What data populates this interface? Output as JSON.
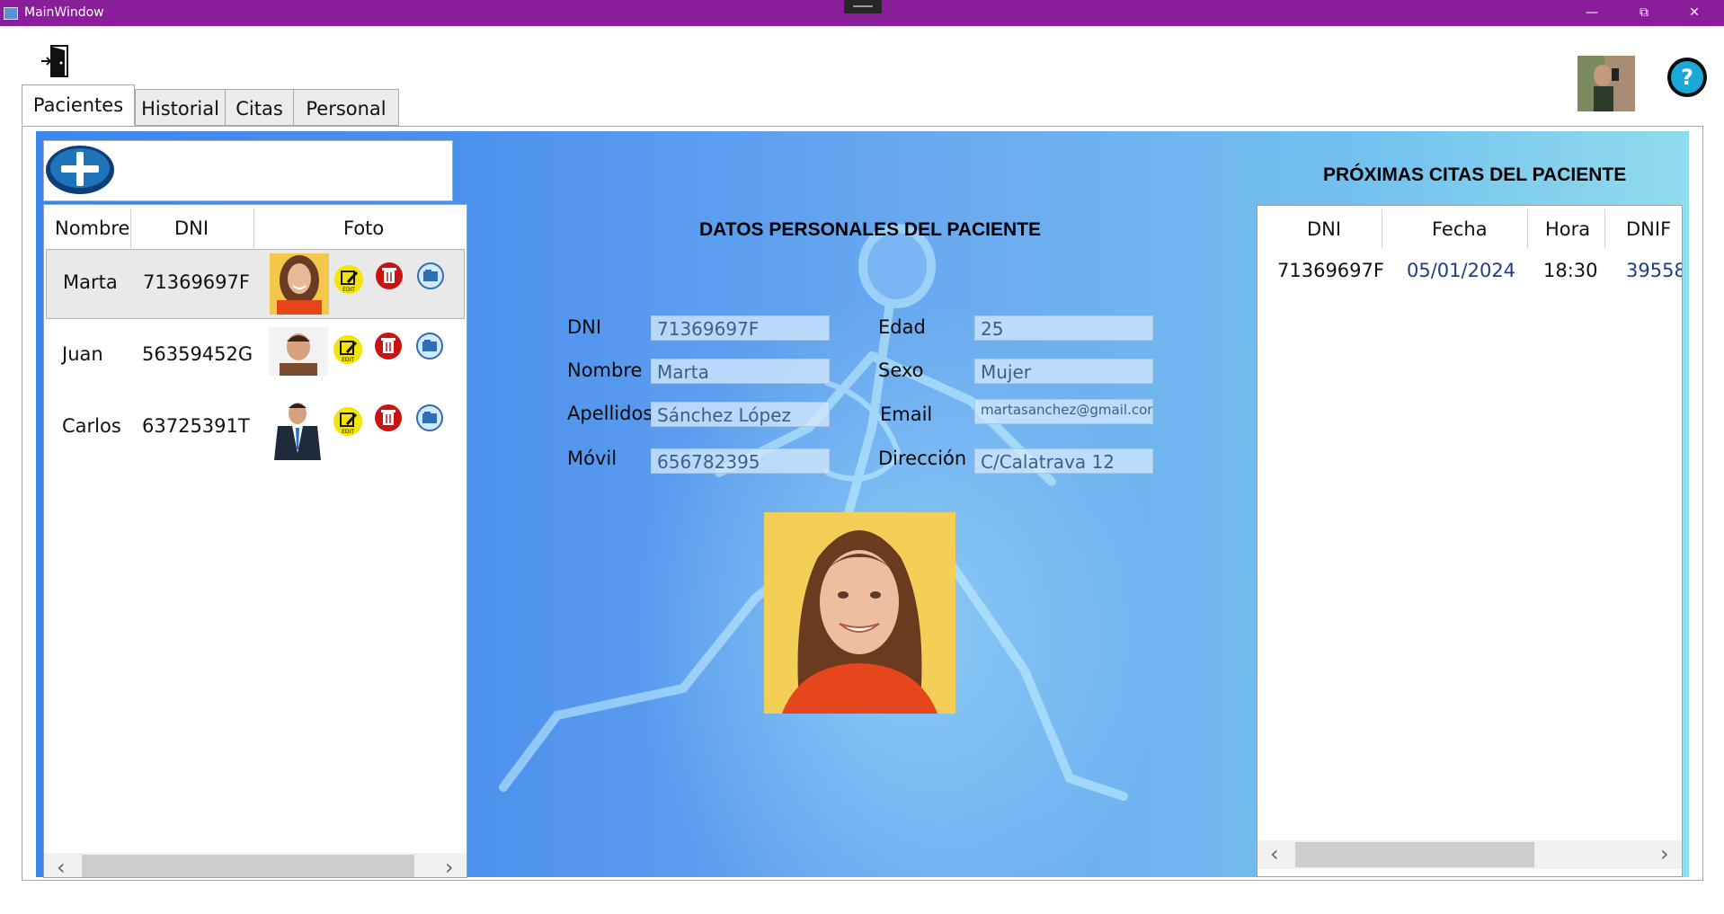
{
  "window": {
    "title": "MainWindow",
    "minimize": "—",
    "restore": "⧉",
    "close": "✕"
  },
  "tabs": [
    {
      "label": "Pacientes"
    },
    {
      "label": "Historial"
    },
    {
      "label": "Citas"
    },
    {
      "label": "Personal"
    }
  ],
  "patients_table": {
    "headers": {
      "nombre": "Nombre",
      "dni": "DNI",
      "foto": "Foto"
    },
    "rows": [
      {
        "nombre": "Marta",
        "dni": "71369697F"
      },
      {
        "nombre": "Juan",
        "dni": "56359452G"
      },
      {
        "nombre": "Carlos",
        "dni": "63725391T"
      }
    ]
  },
  "details": {
    "title": "DATOS PERSONALES DEL PACIENTE",
    "labels": {
      "dni": "DNI",
      "nombre": "Nombre",
      "apellidos": "Apellidos",
      "movil": "Móvil",
      "edad": "Edad",
      "sexo": "Sexo",
      "email": "Email",
      "direccion": "Dirección"
    },
    "values": {
      "dni": "71369697F",
      "nombre": "Marta",
      "apellidos": "Sánchez López",
      "movil": "656782395",
      "edad": "25",
      "sexo": "Mujer",
      "email": "martasanchez@gmail.com",
      "direccion": "C/Calatrava 12"
    }
  },
  "citas": {
    "title": "PRÓXIMAS CITAS DEL PACIENTE",
    "headers": {
      "dni": "DNI",
      "fecha": "Fecha",
      "hora": "Hora",
      "dnif": "DNIF"
    },
    "rows": [
      {
        "dni": "71369697F",
        "fecha": "05/01/2024",
        "hora": "18:30",
        "dnif": "39558"
      }
    ]
  },
  "icons": [
    "exit-door-icon",
    "add-icon",
    "edit-icon",
    "delete-icon",
    "view-icon",
    "help-icon",
    "avatar"
  ],
  "colors": {
    "titlebar": "#8a1d9a",
    "accent_blue": "#1e5aa8",
    "edit_yellow": "#f5e400",
    "delete_red": "#cc1111"
  }
}
